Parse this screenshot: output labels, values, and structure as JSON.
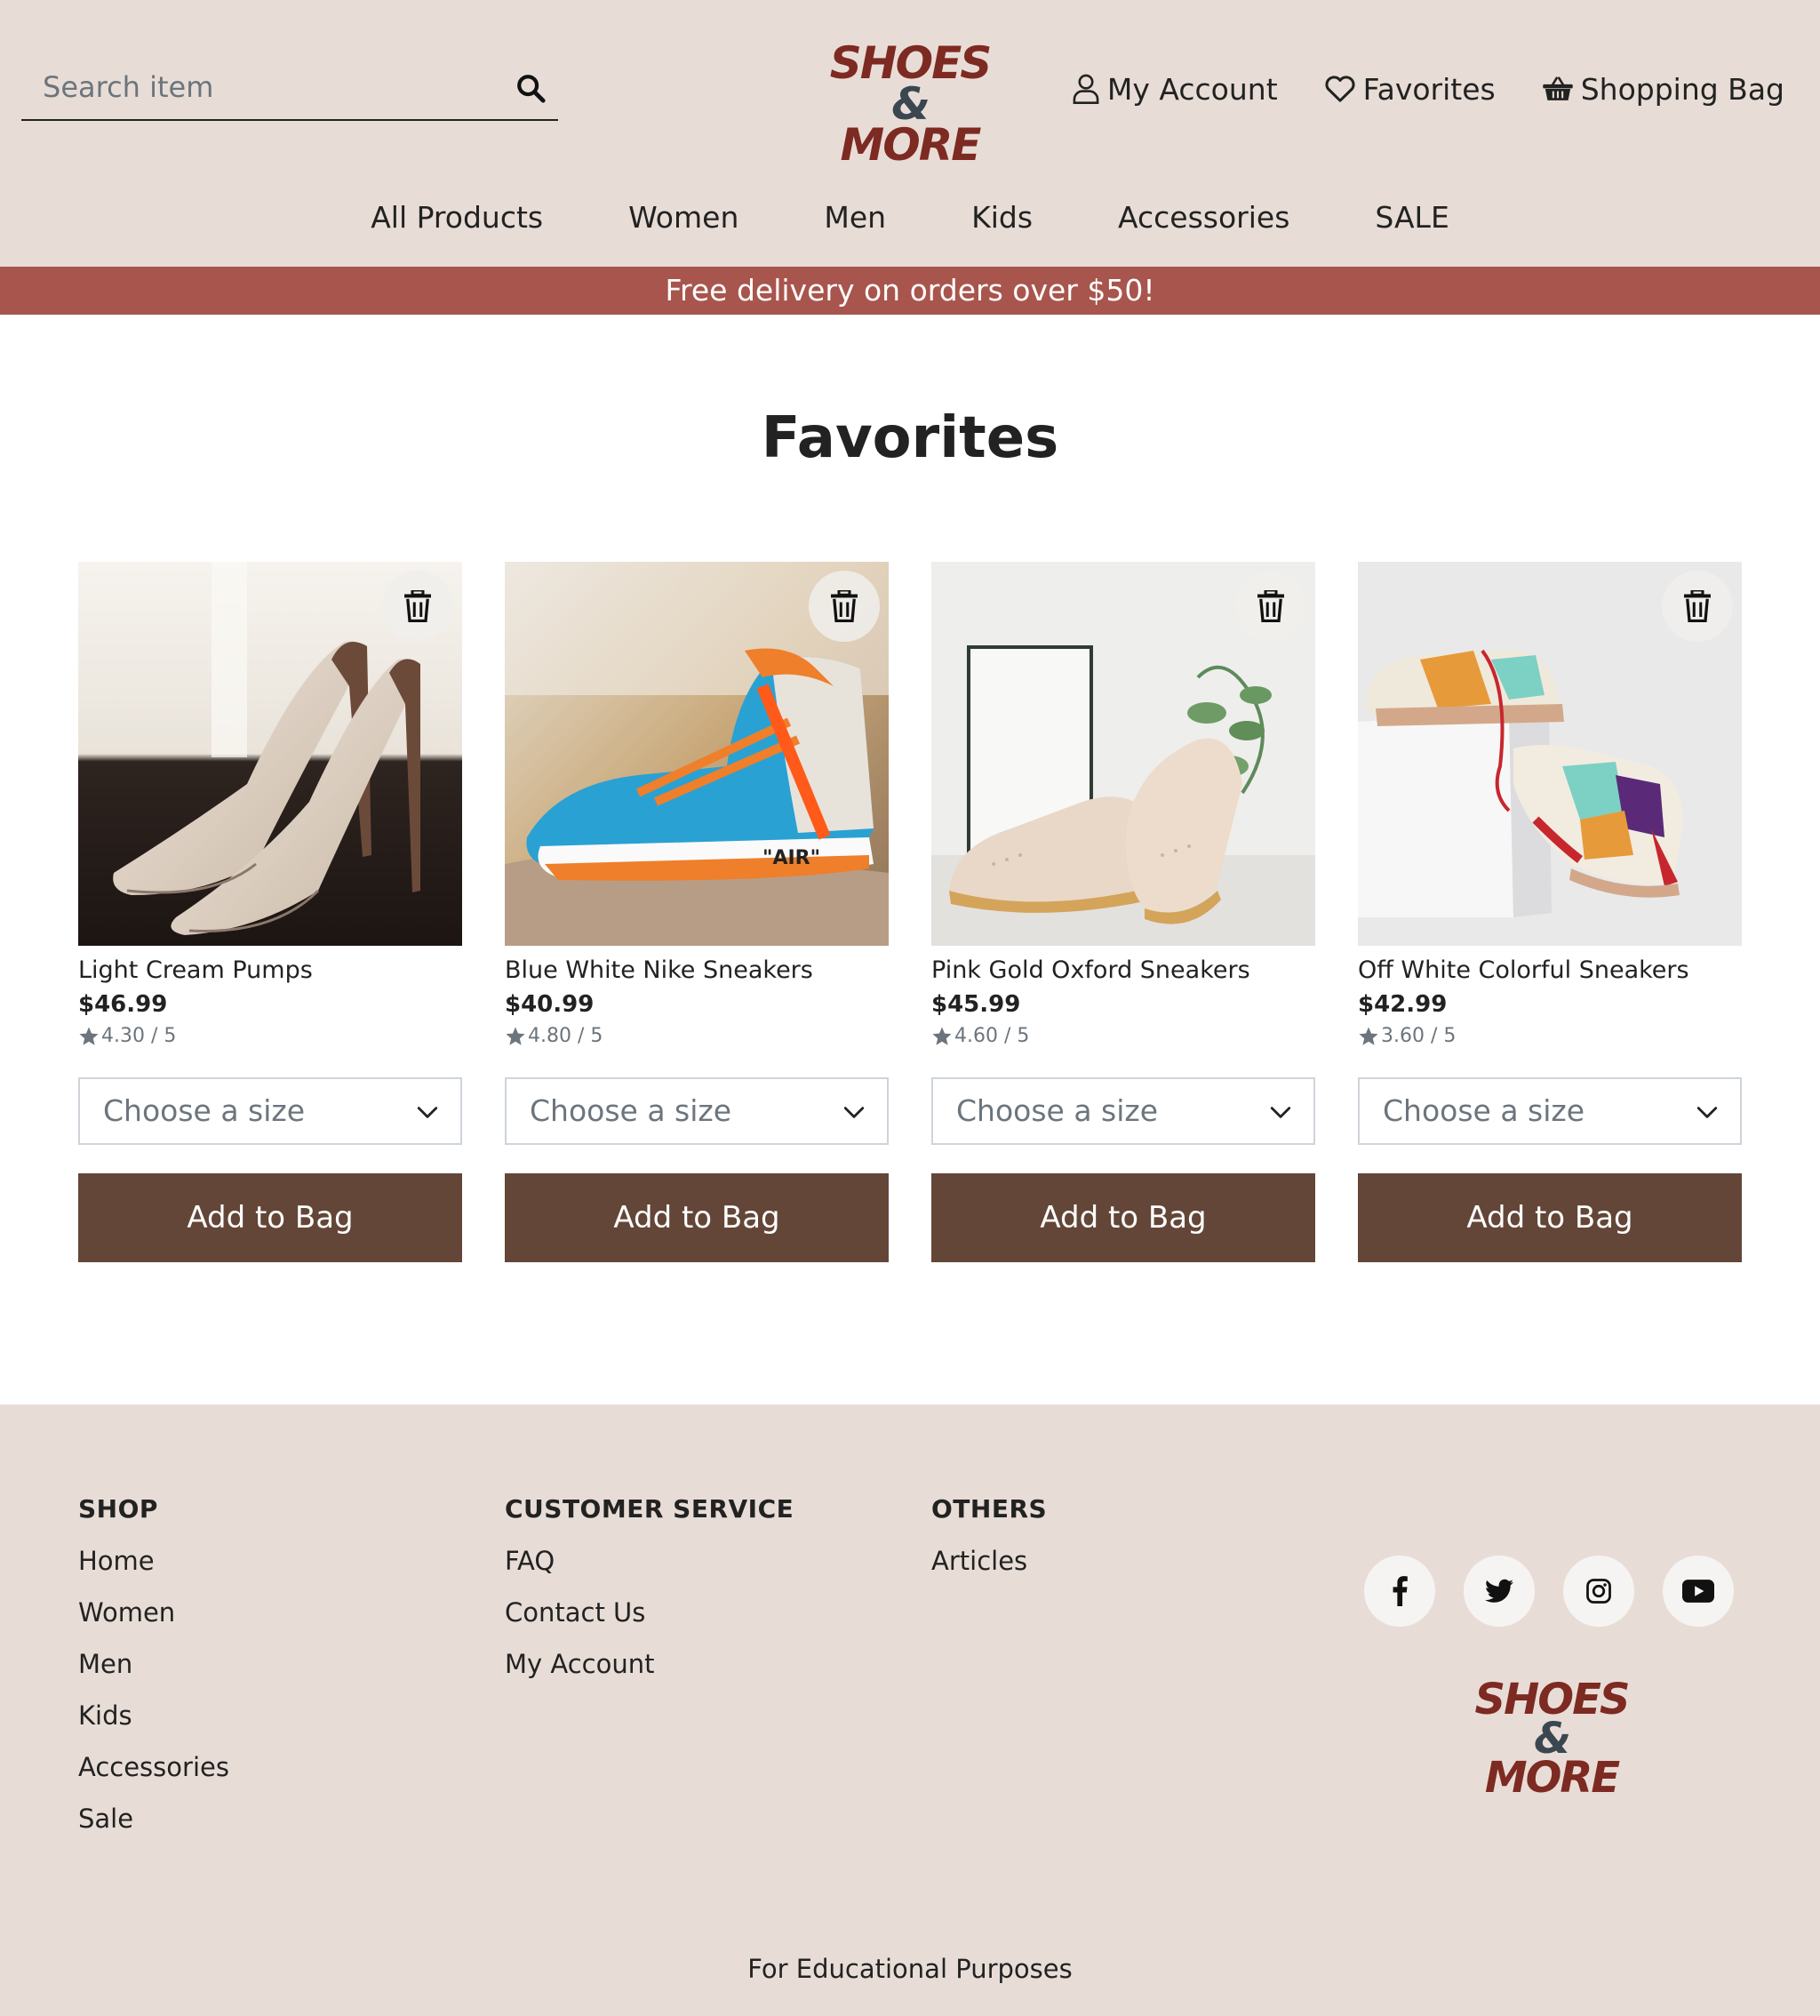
{
  "header": {
    "search": {
      "placeholder": "Search item",
      "value": ""
    },
    "logo": {
      "line1": "SHOES",
      "amp": "&",
      "line2": "MORE"
    },
    "links": {
      "account": "My Account",
      "favorites": "Favorites",
      "bag": "Shopping Bag"
    }
  },
  "nav": [
    "All Products",
    "Women",
    "Men",
    "Kids",
    "Accessories",
    "SALE"
  ],
  "banner": "Free delivery on orders over $50!",
  "page_title": "Favorites",
  "products": [
    {
      "name": "Light Cream Pumps",
      "price": "$46.99",
      "rating": "4.30 / 5",
      "size_placeholder": "Choose a size",
      "button": "Add to Bag"
    },
    {
      "name": "Blue White Nike Sneakers",
      "price": "$40.99",
      "rating": "4.80 / 5",
      "size_placeholder": "Choose a size",
      "button": "Add to Bag"
    },
    {
      "name": "Pink Gold Oxford Sneakers",
      "price": "$45.99",
      "rating": "4.60 / 5",
      "size_placeholder": "Choose a size",
      "button": "Add to Bag"
    },
    {
      "name": "Off White Colorful Sneakers",
      "price": "$42.99",
      "rating": "3.60 / 5",
      "size_placeholder": "Choose a size",
      "button": "Add to Bag"
    }
  ],
  "footer": {
    "shop": {
      "title": "SHOP",
      "links": [
        "Home",
        "Women",
        "Men",
        "Kids",
        "Accessories",
        "Sale"
      ]
    },
    "service": {
      "title": "CUSTOMER SERVICE",
      "links": [
        "FAQ",
        "Contact Us",
        "My Account"
      ]
    },
    "others": {
      "title": "OTHERS",
      "links": [
        "Articles"
      ]
    },
    "socials": [
      "facebook-icon",
      "twitter-icon",
      "instagram-icon",
      "youtube-icon"
    ],
    "note": "For Educational Purposes"
  },
  "colors": {
    "header_bg": "#e8ddd6",
    "banner_bg": "#a8554d",
    "button_bg": "#634638",
    "logo_red": "#7d2a22",
    "logo_slate": "#3a4750"
  }
}
